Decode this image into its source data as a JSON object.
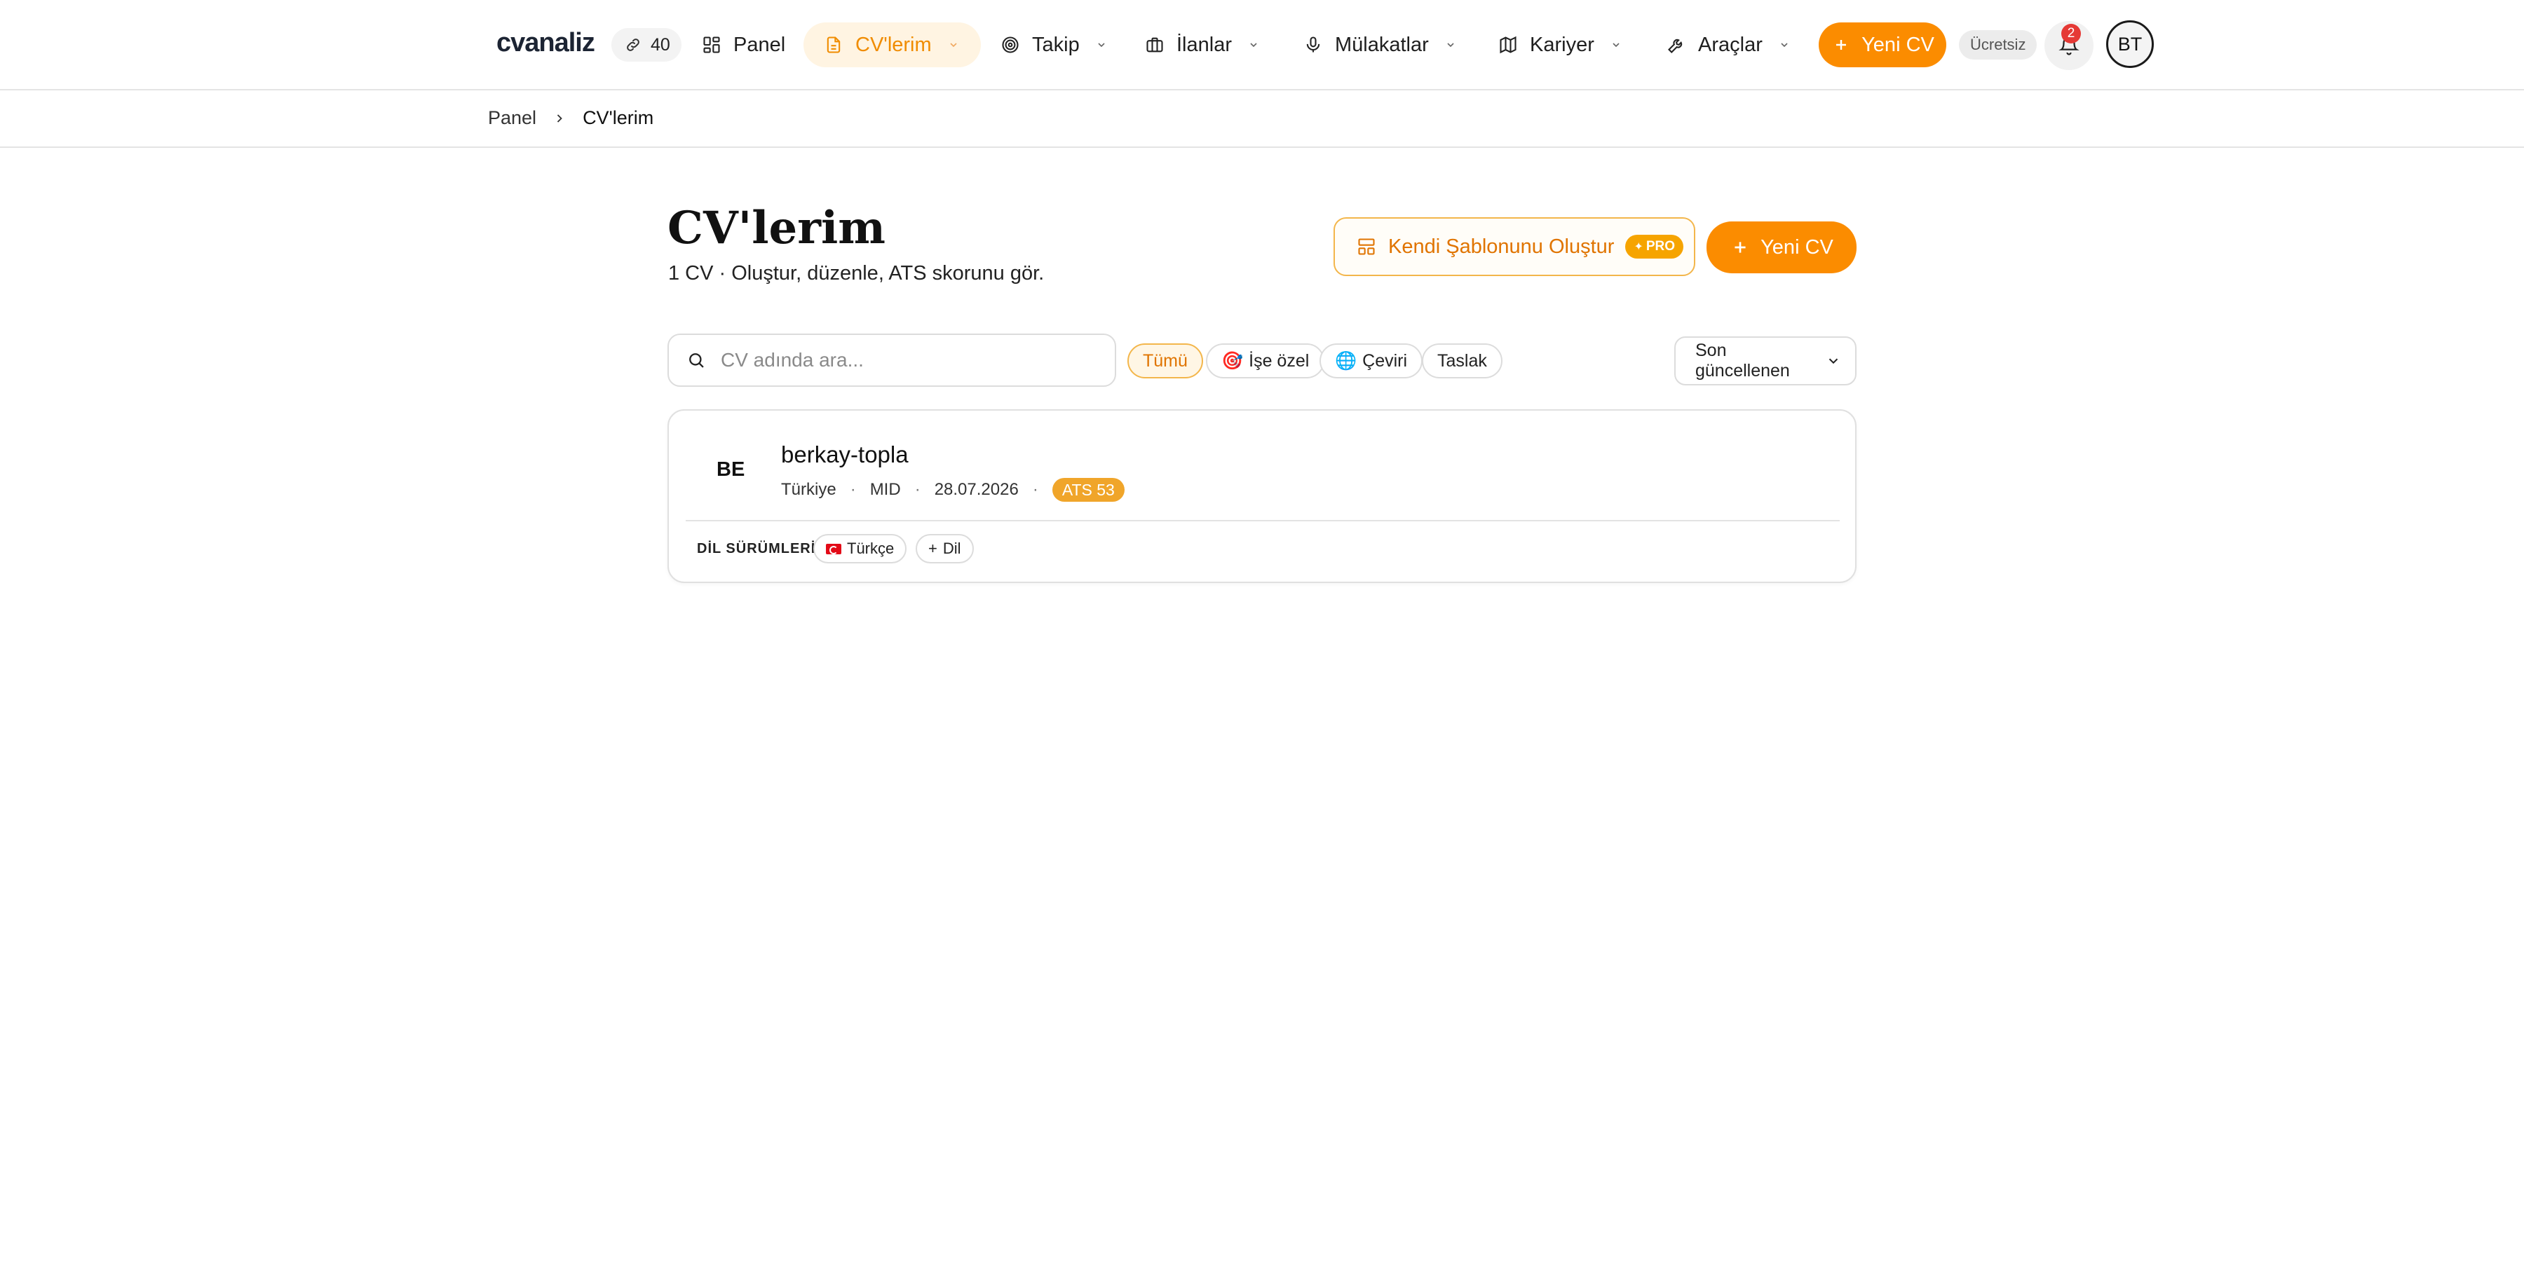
{
  "brand": {
    "logo": "cvanaliz",
    "credits": "40"
  },
  "nav": {
    "items": [
      {
        "label": "Panel"
      },
      {
        "label": "CV'lerim"
      },
      {
        "label": "Takip"
      },
      {
        "label": "İlanlar"
      },
      {
        "label": "Mülakatlar"
      },
      {
        "label": "Kariyer"
      },
      {
        "label": "Araçlar"
      }
    ],
    "new_cv": "Yeni CV",
    "plan": "Ücretsiz",
    "notifications": "2",
    "avatar_initials": "BT"
  },
  "breadcrumb": {
    "root": "Panel",
    "current": "CV'lerim"
  },
  "header": {
    "title": "CV'lerim",
    "subtitle": "1 CV · Oluştur, düzenle, ATS skorunu gör.",
    "template_button": "Kendi Şablonunu Oluştur",
    "pro_badge": "PRO",
    "new_cv_button": "Yeni CV"
  },
  "filters": {
    "search_placeholder": "CV adında ara...",
    "chips": [
      "Tümü",
      "İşe özel",
      "Çeviri",
      "Taslak"
    ],
    "sort": "Son güncellenen"
  },
  "cvs": [
    {
      "initials": "BE",
      "name": "berkay-topla",
      "country": "Türkiye",
      "level": "MID",
      "date": "28.07.2026",
      "ats": "ATS 53",
      "lang_label": "DİL SÜRÜMLERİ",
      "language": "Türkçe",
      "add_lang": "Dil"
    }
  ],
  "colors": {
    "accent": "#fb8c00",
    "accent_soft": "#fff4e2",
    "ats_badge": "#f0a52a",
    "notification": "#e53935"
  }
}
